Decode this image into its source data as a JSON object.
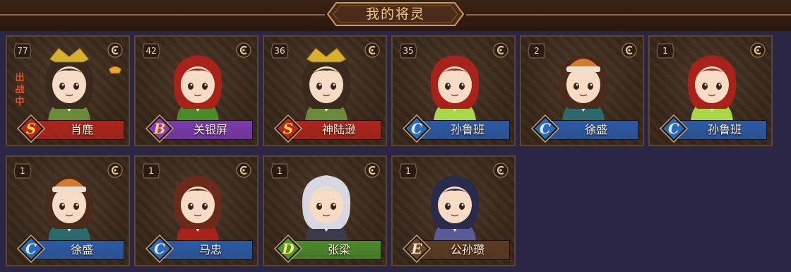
{
  "header": {
    "title": "我的将灵"
  },
  "cards": [
    {
      "level": "77",
      "name": "肖鹿",
      "rank": "S",
      "theme": "S",
      "battle_tag": "出战中",
      "has_ingot": true,
      "hair": "#3a2a1e",
      "outfit": "#6b8a3a",
      "crown": true
    },
    {
      "level": "42",
      "name": "关银屏",
      "rank": "B",
      "theme": "B",
      "hair": "#a8221a",
      "outfit": "#4a8a2a"
    },
    {
      "level": "36",
      "name": "神陆逊",
      "rank": "S",
      "theme": "S",
      "hair": "#3a2a1e",
      "outfit": "#6b8a3a",
      "crown": true
    },
    {
      "level": "35",
      "name": "孙鲁班",
      "rank": "C",
      "theme": "C",
      "hair": "#a8221a",
      "outfit": "#a8d84a"
    },
    {
      "level": "2",
      "name": "徐盛",
      "rank": "C",
      "theme": "C",
      "hair": "#4a2a1a",
      "outfit": "#2a6a6a",
      "helmet": true
    },
    {
      "level": "1",
      "name": "孙鲁班",
      "rank": "C",
      "theme": "C",
      "hair": "#a8221a",
      "outfit": "#a8d84a"
    },
    {
      "level": "1",
      "name": "徐盛",
      "rank": "C",
      "theme": "C",
      "hair": "#4a2a1a",
      "outfit": "#2a6a6a",
      "helmet": true
    },
    {
      "level": "1",
      "name": "马忠",
      "rank": "C",
      "theme": "C",
      "hair": "#6a2a1a",
      "outfit": "#a8221a"
    },
    {
      "level": "1",
      "name": "张梁",
      "rank": "D",
      "theme": "D",
      "hair": "#d8d8e0",
      "outfit": "#3a3a4a"
    },
    {
      "level": "1",
      "name": "公孙瓒",
      "rank": "E",
      "theme": "E",
      "hair": "#2a2a4a",
      "outfit": "#5a5a9a"
    }
  ],
  "themes": {
    "S": {
      "plate": "#b0241c",
      "badge": "#b8281c",
      "letter": "#ffd24a"
    },
    "B": {
      "plate": "#7a3ab0",
      "badge": "#8a3ac0",
      "letter": "#ffd24a"
    },
    "C": {
      "plate": "#2a5aa8",
      "badge": "#2a6ab8",
      "letter": "#dde8ff"
    },
    "D": {
      "plate": "#4a8a2a",
      "badge": "#4a9a2a",
      "letter": "#ffe27a"
    },
    "E": {
      "plate": "#5a3a22",
      "badge": "#6a4628",
      "letter": "#f5e6c8"
    }
  }
}
